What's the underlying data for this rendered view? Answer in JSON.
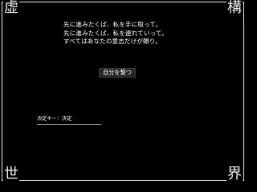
{
  "frame": {
    "corner_top_left": "虚",
    "corner_top_right": "構",
    "corner_bottom_left": "世",
    "corner_bottom_right": "界"
  },
  "story": {
    "lines": [
      "先に進みたくば、私を手に取って。",
      "先に進みたくば、私を連れていって。",
      "すべてはあなたの意志だけが頼り。"
    ]
  },
  "choice": {
    "label": "自分を繋つ"
  },
  "hint": {
    "text": "決定キー：決定"
  }
}
